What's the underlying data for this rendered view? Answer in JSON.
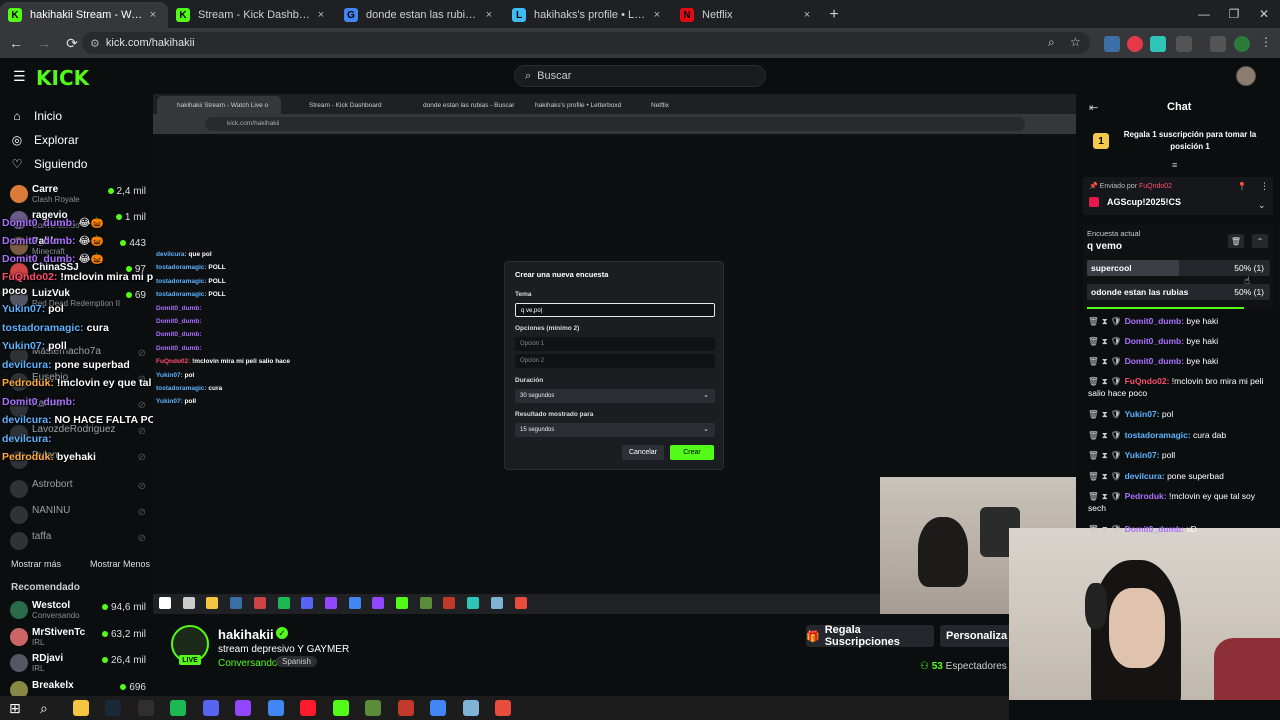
{
  "browser": {
    "tabs": [
      {
        "label": "hakihakii Stream - Watch Live o",
        "favicon": "K",
        "color": "#53fc18",
        "active": true
      },
      {
        "label": "Stream - Kick Dashboard",
        "favicon": "K",
        "color": "#53fc18",
        "active": false
      },
      {
        "label": "donde estan las rubias - Buscar",
        "favicon": "G",
        "color": "#4285f4",
        "active": false
      },
      {
        "label": "hakihaks's profile • Letterboxd",
        "favicon": "L",
        "color": "#40bcf4",
        "active": false
      },
      {
        "label": "Netflix",
        "favicon": "N",
        "color": "#e50914",
        "active": false
      }
    ],
    "url": "kick.com/hakihakii",
    "close_glyph": "×",
    "new_tab_glyph": "+",
    "back_glyph": "←",
    "forward_glyph": "→",
    "reload_glyph": "⟳"
  },
  "header": {
    "logo": "KICK",
    "search_placeholder": "Buscar"
  },
  "sidebar": {
    "nav": [
      {
        "label": "Inicio",
        "icon": "home-icon",
        "glyph": "⌂"
      },
      {
        "label": "Explorar",
        "icon": "compass-icon",
        "glyph": "◎"
      },
      {
        "label": "Siguiendo",
        "icon": "heart-icon",
        "glyph": "♡"
      }
    ],
    "following": [
      {
        "name": "Carre",
        "sub": "Clash Royale",
        "viewers": "2,4 mil",
        "color": "#d97b3a"
      },
      {
        "name": "ragevio",
        "sub": "Conversando",
        "viewers": "1 mil",
        "color": "#6b5a8a"
      },
      {
        "name": "Pablo",
        "sub": "Minecraft",
        "viewers": "443",
        "color": "#7a5c44"
      },
      {
        "name": "ChinaSSJ",
        "sub": "",
        "viewers": "97",
        "color": "#c44"
      },
      {
        "name": "LuizVuk",
        "sub": "Red Dead Redemption II",
        "viewers": "69",
        "color": "#556"
      },
      {
        "name": "Masternacho7a",
        "sub": "",
        "viewers": "",
        "color": "#2f3236"
      },
      {
        "name": "Eusebio",
        "sub": "",
        "viewers": "",
        "color": "#2f3236"
      },
      {
        "name": "Karina",
        "sub": "",
        "viewers": "",
        "color": "#2f3236"
      },
      {
        "name": "LavozdeRodriguez",
        "sub": "",
        "viewers": "",
        "color": "#2f3236"
      },
      {
        "name": "Dylan",
        "sub": "",
        "viewers": "",
        "color": "#2f3236"
      },
      {
        "name": "Astrobort",
        "sub": "",
        "viewers": "",
        "color": "#2f3236"
      },
      {
        "name": "NANINU",
        "sub": "",
        "viewers": "",
        "color": "#2f3236"
      },
      {
        "name": "taffa",
        "sub": "",
        "viewers": "",
        "color": "#2f3236"
      }
    ],
    "show_more": "Mostrar más",
    "show_less": "Mostrar Menos",
    "recommended_label": "Recomendado",
    "recommended": [
      {
        "name": "Westcol",
        "sub": "Conversando",
        "viewers": "94,6 mil",
        "color": "#2a6b4a"
      },
      {
        "name": "MrStivenTc",
        "sub": "IRL",
        "viewers": "63,2 mil",
        "color": "#c66"
      },
      {
        "name": "RDjavi",
        "sub": "IRL",
        "viewers": "26,4 mil",
        "color": "#556"
      },
      {
        "name": "Breakelx",
        "sub": "",
        "viewers": "696",
        "color": "#884"
      }
    ]
  },
  "overlay_chat": [
    {
      "user": "Domit0_dumb:",
      "text": "😂🎃",
      "cls": "u-purple"
    },
    {
      "user": "Domit0_dumb:",
      "text": "😂🎃",
      "cls": "u-purple"
    },
    {
      "user": "Domit0_dumb:",
      "text": "😂🎃",
      "cls": "u-purple"
    },
    {
      "user": "FuQndo02:",
      "text": "!mclovin mira mi peli salio hace",
      "cls": "u-red"
    },
    {
      "user": "",
      "text": "poco",
      "cls": "u-white"
    },
    {
      "user": "Yukin07:",
      "text": "pol",
      "cls": "u-blue"
    },
    {
      "user": "tostadoramagic:",
      "text": "cura",
      "cls": "u-blue"
    },
    {
      "user": "Yukin07:",
      "text": "poll",
      "cls": "u-blue"
    },
    {
      "user": "devilcura:",
      "text": "pone superbad",
      "cls": "u-blue"
    },
    {
      "user": "Pedroduk:",
      "text": "!mclovin ey que tal soy sech",
      "cls": "u-orange"
    },
    {
      "user": "Domit0_dumb:",
      "text": "",
      "cls": "u-purple"
    },
    {
      "user": "devilcura:",
      "text": "NO HACE FALTA POLL",
      "cls": "u-blue"
    },
    {
      "user": "devilcura:",
      "text": "",
      "cls": "u-blue"
    },
    {
      "user": "Pedroduk:",
      "text": "byehaki",
      "cls": "u-orange"
    }
  ],
  "inner_browser": {
    "tabs": [
      "hakihakii Stream - Watch Live o",
      "Stream - Kick Dashboard",
      "donde estan las rubias - Buscar",
      "hakihaks's profile • Letterboxd",
      "Netflix"
    ],
    "url": "kick.com/hakihakii",
    "chat": [
      {
        "user": "devilcura:",
        "text": "que pol"
      },
      {
        "user": "tostadoramagic:",
        "text": "POLL"
      },
      {
        "user": "tostadoramagic:",
        "text": "POLL"
      },
      {
        "user": "tostadoramagic:",
        "text": "POLL"
      },
      {
        "user": "Domit0_dumb:",
        "text": ""
      },
      {
        "user": "Domit0_dumb:",
        "text": ""
      },
      {
        "user": "Domit0_dumb:",
        "text": ""
      },
      {
        "user": "Domit0_dumb:",
        "text": ""
      },
      {
        "user": "FuQndo02:",
        "text": "!mclovin mira mi peli salio hace"
      },
      {
        "user": "Yukin07:",
        "text": "pol"
      },
      {
        "user": "tostadoramagic:",
        "text": "cura"
      },
      {
        "user": "Yukin07:",
        "text": "poll"
      }
    ]
  },
  "modal": {
    "title": "Crear una nueva encuesta",
    "topic_label": "Tema",
    "topic_value": "q ve,po|",
    "options_label": "Opciones (mínimo 2)",
    "option1_placeholder": "Opción 1",
    "option2_placeholder": "Opción 2",
    "duration_label": "Duración",
    "duration_value": "30 segundos",
    "result_label": "Resultado mostrado para",
    "result_value": "15 segundos",
    "cancel": "Cancelar",
    "create": "Crear"
  },
  "channel": {
    "name": "hakihakii",
    "live": "LIVE",
    "title": "stream depresivo Y GAYMER",
    "category": "Conversando",
    "language": "Spanish",
    "subs_button": "Regala Suscripciones",
    "custom_button": "Personaliza tu",
    "viewers": "53",
    "viewers_label": "Espectadores"
  },
  "chat": {
    "title": "Chat",
    "gift_text": "Regala 1 suscripción para tomar la posición 1",
    "gift_rank": "1",
    "pinned_by": "Enviado por",
    "pinned_by_user": "FuQndo02",
    "pinned_msg": "AGScup!2025!CS",
    "poll_label": "Encuesta actual",
    "poll_question": "q vemo",
    "poll_options": [
      {
        "name": "supercool",
        "pct": "50% (1)",
        "share": 0.5
      },
      {
        "name": "odonde estan las rubias",
        "pct": "50% (1)",
        "share": 0.0
      }
    ],
    "poll_time_remaining": 0.86,
    "messages": [
      {
        "user": "Domit0_dumb:",
        "text": "bye haki",
        "cls": "u-purple"
      },
      {
        "user": "Domit0_dumb:",
        "text": "bye haki",
        "cls": "u-purple"
      },
      {
        "user": "Domit0_dumb:",
        "text": "bye haki",
        "cls": "u-purple"
      },
      {
        "user": "FuQndo02:",
        "text": "!mclovin bro mira mi peli salio hace poco",
        "cls": "u-red"
      },
      {
        "user": "Yukin07:",
        "text": "pol",
        "cls": "u-blue"
      },
      {
        "user": "tostadoramagic:",
        "text": "cura dab",
        "cls": "u-blue"
      },
      {
        "user": "Yukin07:",
        "text": "poll",
        "cls": "u-blue"
      },
      {
        "user": "devilcura:",
        "text": "pone superbad",
        "cls": "u-blue"
      },
      {
        "user": "Pedroduk:",
        "text": "!mclovin ey que tal soy sech",
        "cls": "u-purple"
      },
      {
        "user": "Domit0_dumb:",
        "text": "xD",
        "cls": "u-purple"
      }
    ]
  },
  "taskbar": {
    "icons": [
      "search-icon",
      "file-explorer-icon",
      "steam-icon",
      "obs-icon",
      "spotify-icon",
      "discord-icon",
      "twitch-icon",
      "chrome-icon",
      "opera-icon",
      "kick-icon",
      "minecraft-icon",
      "app-icon",
      "chrome-icon",
      "notepad-icon",
      "app-icon"
    ],
    "colors": [
      "#fff",
      "#f5c542",
      "#1b2838",
      "#302e31",
      "#1db954",
      "#5865f2",
      "#9146ff",
      "#4285f4",
      "#ff1b2d",
      "#53fc18",
      "#5b8c3a",
      "#c0392b",
      "#4285f4",
      "#7fb3d5",
      "#e74c3c"
    ]
  }
}
